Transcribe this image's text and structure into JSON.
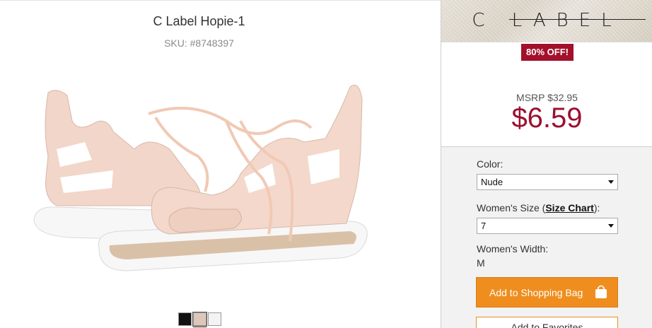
{
  "product": {
    "title": "C Label Hopie-1",
    "sku": "SKU: #8748397",
    "image_alt": "Nude lace-up gladiator sandals"
  },
  "swatches": [
    {
      "name": "Black",
      "color": "#111111"
    },
    {
      "name": "Nude",
      "color": "#dec7b9"
    },
    {
      "name": "White",
      "color": "#f3f3f3"
    }
  ],
  "brand": {
    "logo_text": "C LABEL",
    "discount_badge": "80% OFF!"
  },
  "pricing": {
    "msrp": "MSRP $32.95",
    "price": "$6.59"
  },
  "options": {
    "color_label": "Color:",
    "color_value": "Nude",
    "size_label_prefix": "Women's Size (",
    "size_chart_link": "Size Chart",
    "size_label_suffix": "):",
    "size_value": "7",
    "width_label": "Women's Width:",
    "width_value": "M"
  },
  "actions": {
    "add_to_bag": "Add to Shopping Bag",
    "add_to_favorites": "Add to Favorites"
  },
  "colors": {
    "price_red": "#9b1030",
    "badge_red": "#a3102b",
    "button_orange": "#ef8e1f"
  }
}
